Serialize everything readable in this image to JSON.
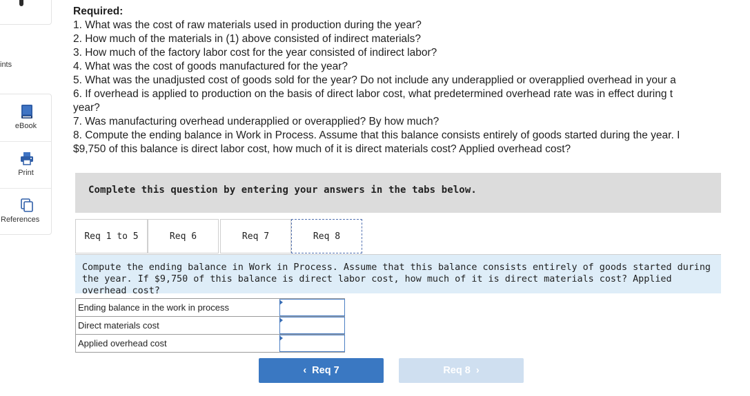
{
  "rail": {
    "hints_label": "ints",
    "items": [
      {
        "label": "eBook",
        "icon": "book-icon"
      },
      {
        "label": "Print",
        "icon": "printer-icon"
      },
      {
        "label": "References",
        "icon": "copy-pages-icon"
      }
    ]
  },
  "question": {
    "heading": "Required:",
    "lines": [
      "1. What was the cost of raw materials used in production during the year?",
      "2. How much of the materials in (1) above consisted of indirect materials?",
      "3. How much of the factory labor cost for the year consisted of indirect labor?",
      "4. What was the cost of goods manufactured for the year?",
      "5. What was the unadjusted cost of goods sold for the year? Do not include any underapplied or overapplied overhead in your a",
      "6. If overhead is applied to production on the basis of direct labor cost, what predetermined overhead rate was in effect during t",
      "year?",
      "7. Was manufacturing overhead underapplied or overapplied? By how much?",
      "8. Compute the ending balance in Work in Process. Assume that this balance consists entirely of goods started during the year. I",
      "$9,750 of this balance is direct labor cost, how much of it is direct materials cost? Applied overhead cost?"
    ]
  },
  "banner": "Complete this question by entering your answers in the tabs below.",
  "tabs": [
    {
      "label": "Req 1 to 5",
      "active": false
    },
    {
      "label": "Req 6",
      "active": false
    },
    {
      "label": "Req 7",
      "active": false
    },
    {
      "label": "Req 8",
      "active": true
    }
  ],
  "instruction": "Compute the ending balance in Work in Process. Assume that this balance consists entirely of goods started during the year. If $9,750 of this balance is direct labor cost, how much of it is direct materials cost? Applied overhead cost?",
  "answers": [
    {
      "label": "Ending balance in the work in process",
      "value": ""
    },
    {
      "label": "Direct materials cost",
      "value": ""
    },
    {
      "label": "Applied overhead cost",
      "value": ""
    }
  ],
  "nav": {
    "prev_label": "Req 7",
    "prev_icon": "chevron-left-icon",
    "next_label": "Req 8",
    "next_icon": "chevron-right-icon"
  },
  "colors": {
    "accent": "#3a78c2",
    "accent_disabled": "#cfdff0",
    "banner": "#dcdcdc",
    "instruction_bg": "#deedf8"
  }
}
